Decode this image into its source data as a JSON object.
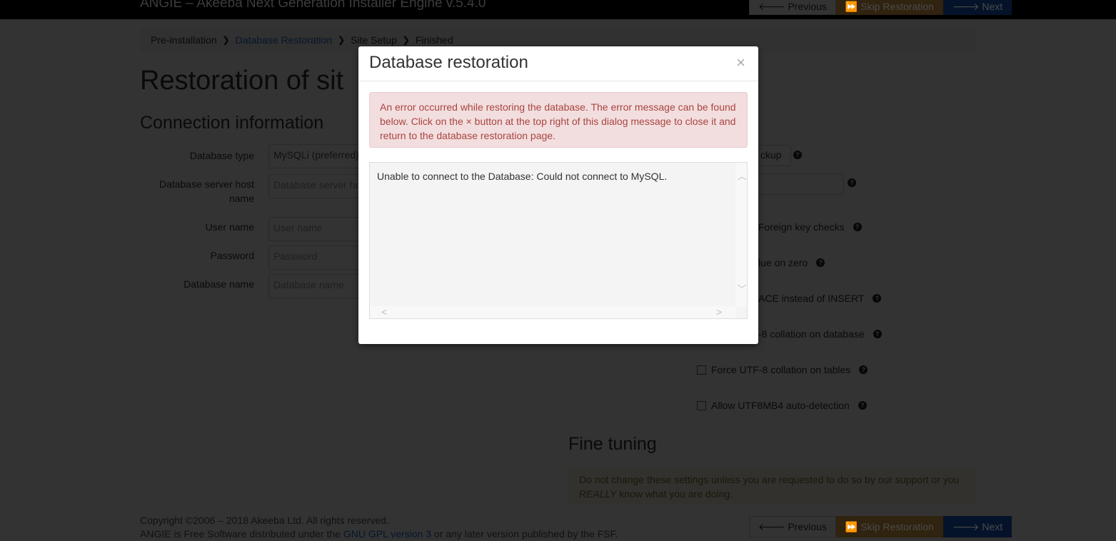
{
  "app": {
    "title": "ANGIE – Akeeba Next Generation Installer Engine v.5.4.0"
  },
  "toolbar": {
    "previous": "Previous",
    "skip": "Skip Restoration",
    "next": "Next"
  },
  "breadcrumb": [
    "Pre-installation",
    "Database Restoration",
    "Site Setup",
    "Finished"
  ],
  "page": {
    "title": "Restoration of sit",
    "connection_heading": "Connection information",
    "fields": [
      {
        "label": "Database type",
        "value": "MySQLi (preferred)"
      },
      {
        "label": "Database server host name",
        "placeholder": "Database server ho"
      },
      {
        "label": "User name",
        "placeholder": "User name"
      },
      {
        "label": "Password",
        "placeholder": "Password"
      },
      {
        "label": "Database name",
        "placeholder": "Database name"
      }
    ],
    "right": {
      "backup_button": "ckup",
      "options": [
        "Foreign key checks",
        "lue on zero",
        "ACE instead of INSERT",
        "-8 collation on database"
      ],
      "checkboxes": [
        {
          "label": "Force UTF-8 collation on tables",
          "checked": false
        },
        {
          "label": "Allow UTF8MB4 auto-detection",
          "checked": false
        }
      ]
    },
    "fine_tuning": "Fine tuning",
    "warning_pre": "Do not change these settings unless you are requested to do so by our support or you ",
    "warning_em": "REALLY",
    "warning_post": " know what you are doing."
  },
  "footer": {
    "copyright": "Copyright ©2006 – 2018 Akeeba Ltd. All rights reserved.",
    "license_pre": "ANGIE is Free Software distributed under the ",
    "license_link": "GNU GPL version 3",
    "license_post": " or any later version published by the FSF."
  },
  "modal": {
    "title": "Database restoration",
    "close": "×",
    "alert": "An error occurred while restoring the database. The error message can be found below. Click on the × button at the top right of this dialog message to close it and return to the database restoration page.",
    "error": "Unable to connect to the Database: Could not connect to MySQL."
  }
}
